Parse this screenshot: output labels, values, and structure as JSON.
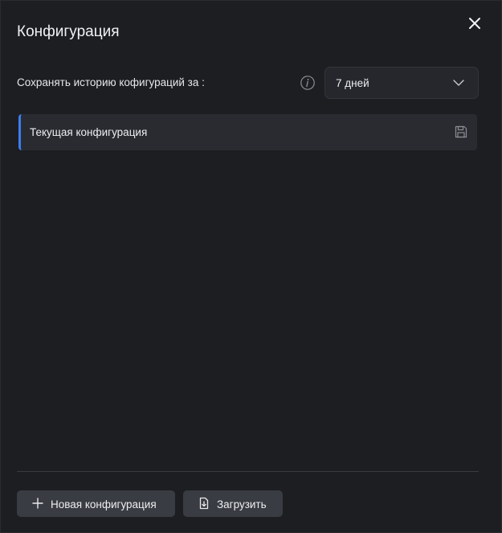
{
  "dialog": {
    "title": "Конфигурация"
  },
  "history": {
    "label": "Сохранять историю кофигураций за :",
    "selected_period": "7 дней"
  },
  "configurations": [
    {
      "label": "Текущая конфигурация"
    }
  ],
  "footer": {
    "new_config_label": "Новая конфигурация",
    "upload_label": "Загрузить"
  },
  "colors": {
    "background": "#1d1e22",
    "accent": "#3b7df0",
    "button": "#3a3c43"
  },
  "icons": {
    "close": "close-icon",
    "info": "info-icon",
    "chevron": "chevron-down-icon",
    "save": "save-icon",
    "plus": "plus-icon",
    "upload": "file-download-icon"
  }
}
